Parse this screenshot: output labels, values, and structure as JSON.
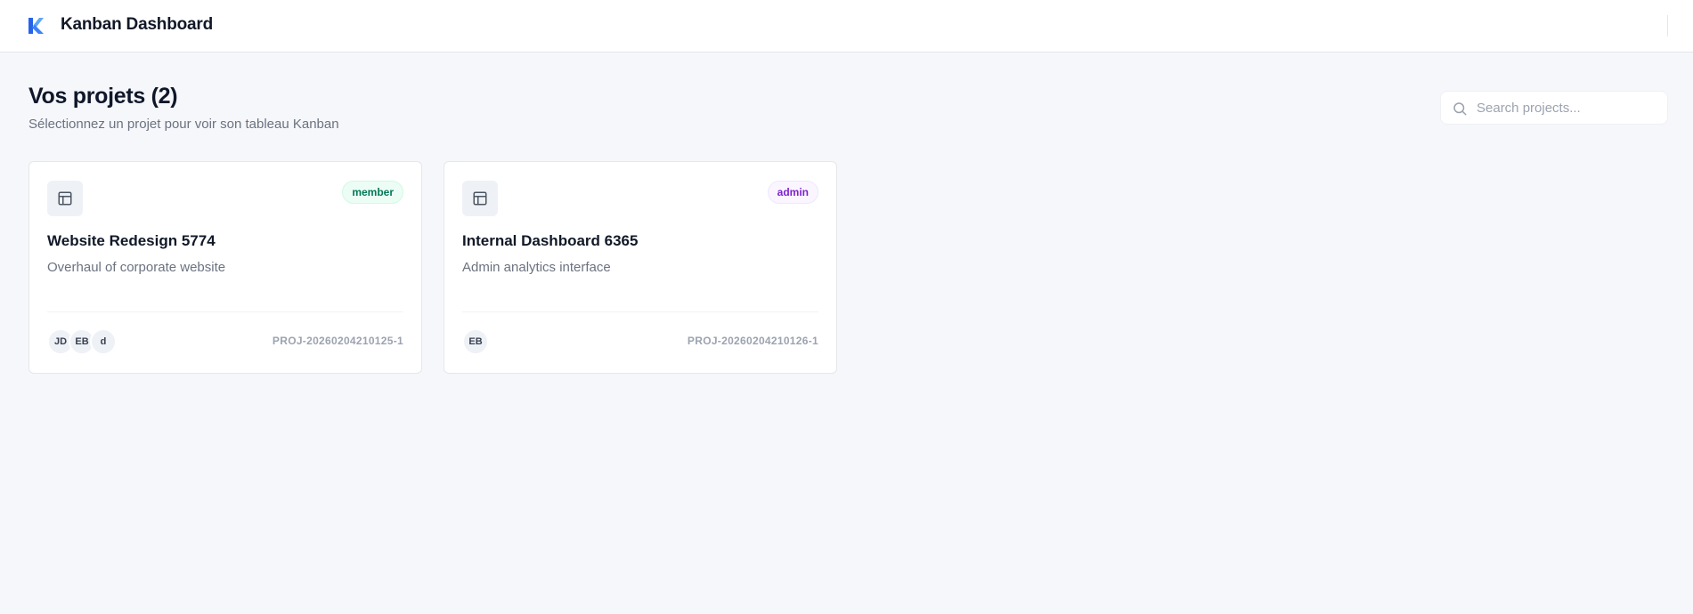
{
  "header": {
    "app_title": "Kanban Dashboard",
    "logo_icon": "kanban-logo-icon"
  },
  "main": {
    "title": "Vos projets (2)",
    "subtitle": "Sélectionnez un projet pour voir son tableau Kanban",
    "search": {
      "placeholder": "Search projects...",
      "value": "",
      "icon": "search-icon"
    }
  },
  "projects": [
    {
      "name": "Website Redesign 5774",
      "description": "Overhaul of corporate website",
      "role": "member",
      "members": [
        "JD",
        "EB",
        "d"
      ],
      "code": "PROJ-20260204210125-1",
      "icon": "board-layout-icon"
    },
    {
      "name": "Internal Dashboard 6365",
      "description": "Admin analytics interface",
      "role": "admin",
      "members": [
        "EB"
      ],
      "code": "PROJ-20260204210126-1",
      "icon": "board-layout-icon"
    }
  ],
  "colors": {
    "background": "#f6f7fb",
    "member_badge": "#047857",
    "admin_badge": "#7e22ce",
    "logo_blue": "#2563eb",
    "logo_light": "#60a5fa"
  }
}
